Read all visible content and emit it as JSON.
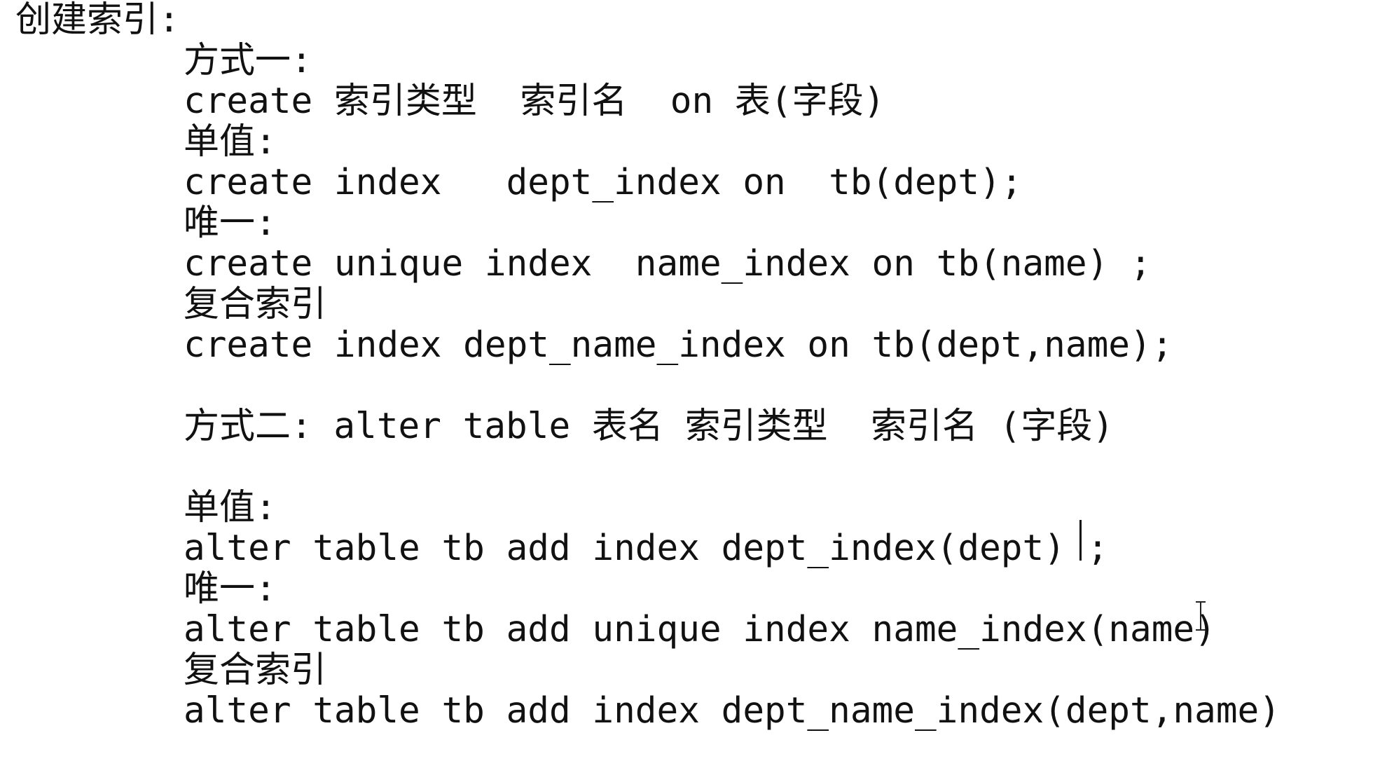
{
  "document": {
    "heading": "创建索引:",
    "lines": [
      "方式一:",
      "create 索引类型  索引名  on 表(字段)",
      "单值:",
      "create index   dept_index on  tb(dept);",
      "唯一:",
      "create unique index  name_index on tb(name) ;",
      "复合索引",
      "create index dept_name_index on tb(dept,name);",
      "",
      "方式二: alter table 表名 索引类型  索引名 (字段)",
      "",
      "单值:",
      "alter table tb add index dept_index(dept) ;",
      "唯一:",
      "alter table tb add unique index name_index(name)",
      "复合索引",
      "alter table tb add index dept_name_index(dept,name)"
    ]
  },
  "cursor": {
    "text_caret_after_line": "alter table tb add index dept_index(dept) ;",
    "mouse_cursor": "i-beam-cursor-icon"
  },
  "colors": {
    "background": "#ffffff",
    "text": "#111111"
  }
}
